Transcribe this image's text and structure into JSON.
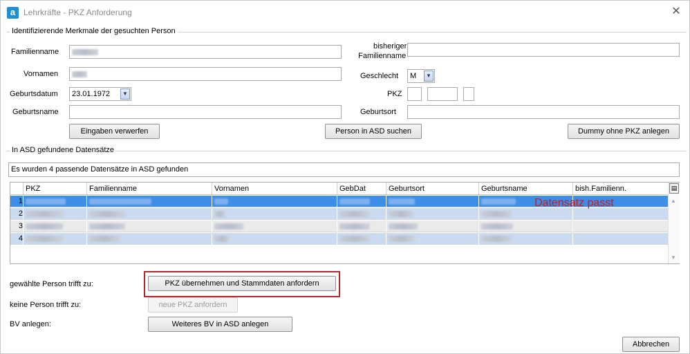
{
  "window": {
    "title": "Lehrkräfte - PKZ Anforderung",
    "app_icon": "a",
    "close_glyph": "✕"
  },
  "search_group": {
    "title": "Identifizierende Merkmale der gesuchten Person",
    "familienname_label": "Familienname",
    "vornamen_label": "Vornamen",
    "geburtsdatum_label": "Geburtsdatum",
    "geburtsdatum_value": "23.01.1972",
    "geburtsname_label": "Geburtsname",
    "bisheriger_label_1": "bisheriger",
    "bisheriger_label_2": "Familienname",
    "geschlecht_label": "Geschlecht",
    "geschlecht_value": "M",
    "pkz_label": "PKZ",
    "geburtsort_label": "Geburtsort",
    "btn_discard": "Eingaben verwerfen",
    "btn_search": "Person in ASD suchen",
    "btn_dummy": "Dummy ohne PKZ anlegen"
  },
  "results_group": {
    "title": "In ASD gefundene Datensätze",
    "status": "Es wurden 4 passende Datensätze in ASD gefunden",
    "columns": [
      "PKZ",
      "Familienname",
      "Vornamen",
      "GebDat",
      "Geburtsort",
      "Geburtsname",
      "bish.Familienn."
    ],
    "rows": [
      {
        "num": "1"
      },
      {
        "num": "2"
      },
      {
        "num": "3"
      },
      {
        "num": "4"
      }
    ],
    "annotation": "Datensatz passt"
  },
  "actions": {
    "chosen_label": "gewählte Person trifft zu:",
    "btn_take_pkz": "PKZ übernehmen und Stammdaten anfordern",
    "none_label": "keine Person trifft zu:",
    "btn_new_pkz": "neue PKZ anfordern",
    "bv_label": "BV anlegen:",
    "btn_bv": "Weiteres BV in ASD anlegen",
    "btn_cancel": "Abbrechen"
  },
  "colors": {
    "selected_row": "#3d8ee6",
    "highlight_frame": "#b3262a",
    "annotation": "#cc1a1a"
  }
}
